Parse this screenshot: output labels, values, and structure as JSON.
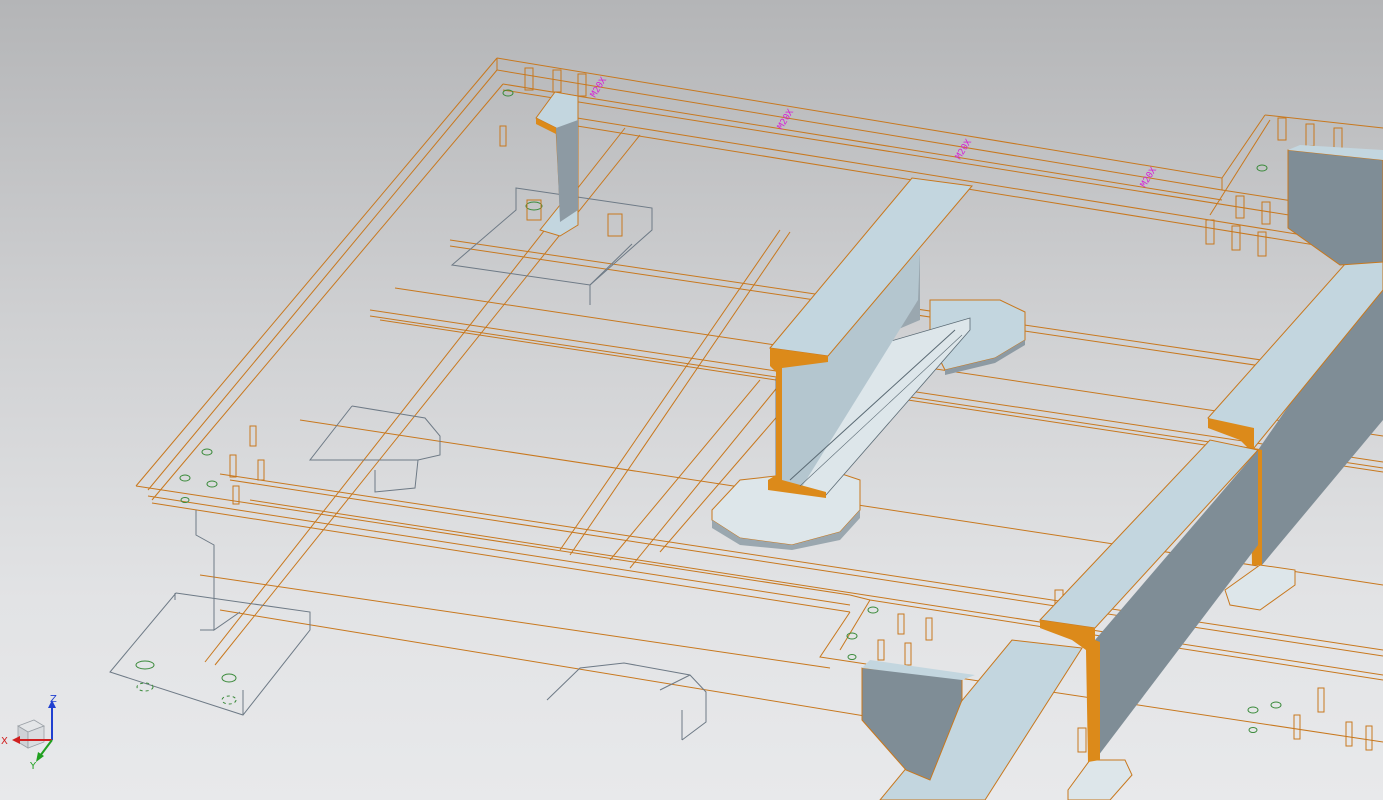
{
  "viewport": {
    "background_top": "#b4b5b7",
    "background_bottom": "#e8e9eb",
    "edge_color": "#c8781e",
    "section_color": "#dc8a1a",
    "face_light": "#c3d6df",
    "face_dark": "#7f8d96",
    "annotation_color": "#d61ed6",
    "sketch_color": "#6e7a86"
  },
  "annotations": {
    "tag1": "M20X",
    "tag2": "M20X",
    "tag3": "M20X",
    "tag4": "M20X"
  },
  "triad": {
    "x_label": "X",
    "y_label": "Y",
    "z_label": "Z",
    "x_color": "#d02020",
    "y_color": "#20a020",
    "z_color": "#2040d0"
  }
}
